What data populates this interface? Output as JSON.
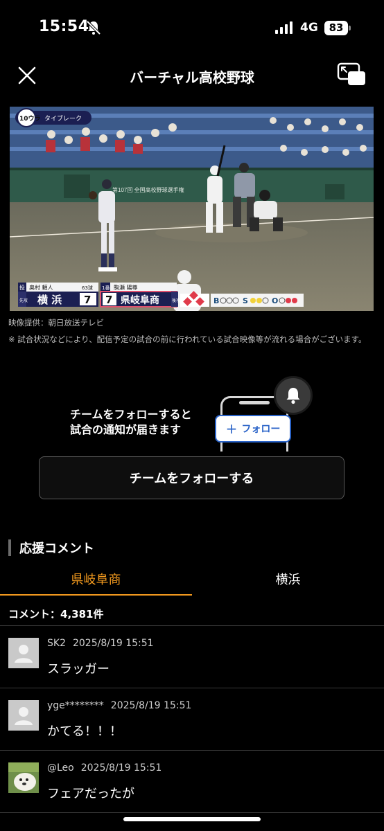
{
  "status_bar": {
    "time": "15:54",
    "network": "4G",
    "battery": "83"
  },
  "header": {
    "title": "バーチャル高校野球"
  },
  "video": {
    "inning_badge": "10ウラ",
    "tiebreak": "タイブレーク",
    "banner": "第107回 全国高校野球選手権",
    "scoreboard": {
      "pitcher_tag": "投",
      "pitcher": "奥村 頼人",
      "pitch_count": "63球",
      "batter_tag": "1番",
      "batter": "駒瀬 陽尊",
      "away_tag": "先攻",
      "away_team": "横 浜",
      "away_score": "7",
      "home_score": "7",
      "home_team": "県岐阜商",
      "home_tag": "後攻",
      "ball_label": "B",
      "strike_label": "S",
      "out_label": "O"
    }
  },
  "credit": "映像提供：朝日放送テレビ",
  "note": "※ 試合状況などにより、配信予定の試合の前に行われている試合映像等が流れる場合がございます。",
  "promo": {
    "line1": "チームをフォローすると",
    "line2": "試合の通知が届きます",
    "pill_label": "フォロー",
    "button_label": "チームをフォローする"
  },
  "comments_section": {
    "title": "応援コメント",
    "tabs": [
      {
        "label": "県岐阜商",
        "active": true
      },
      {
        "label": "横浜",
        "active": false
      }
    ],
    "count_label": "コメント：4,381件",
    "items": [
      {
        "user": "SK2",
        "time": "2025/8/19 15:51",
        "text": "スラッガー"
      },
      {
        "user": "yge********",
        "time": "2025/8/19 15:51",
        "text": "かてる！！！"
      },
      {
        "user": "@Leo",
        "time": "2025/8/19 15:51",
        "text": "フェアだったが"
      }
    ]
  },
  "colors": {
    "accent": "#f39a1e",
    "follow_blue": "#2a63c8"
  }
}
